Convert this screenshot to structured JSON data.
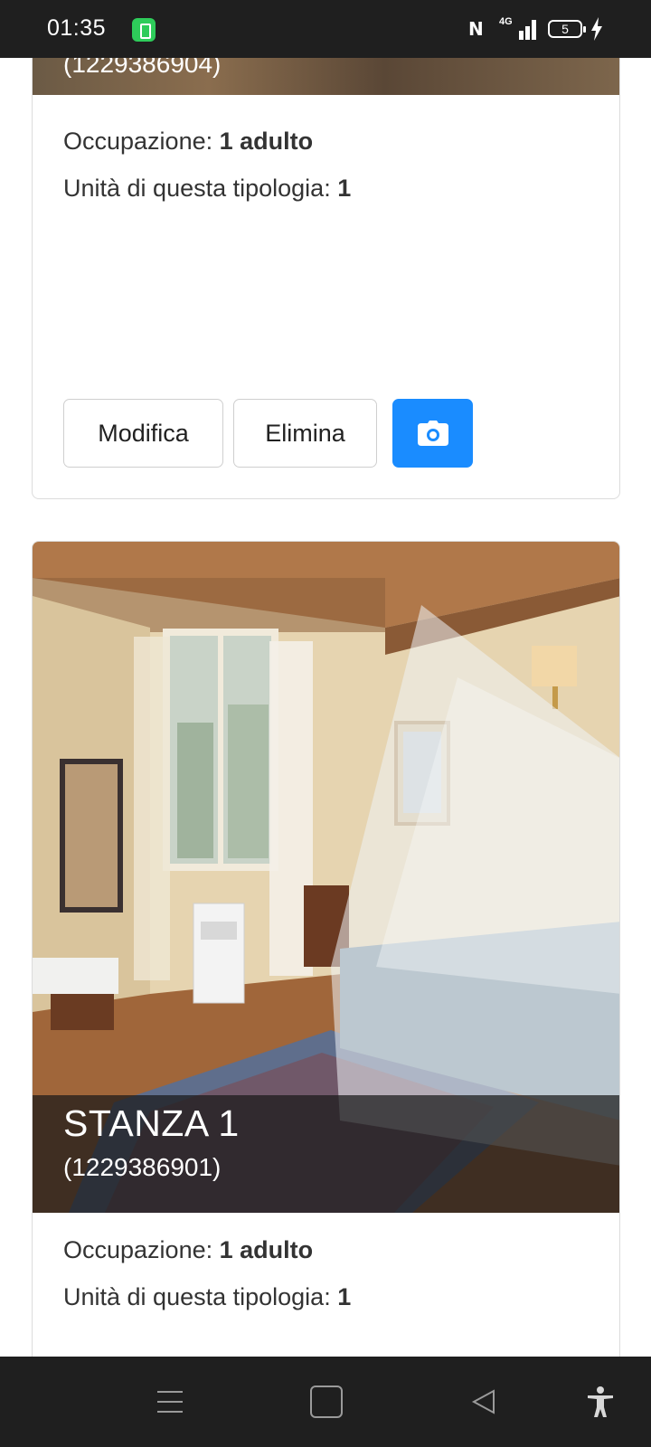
{
  "status_bar": {
    "time": "01:35",
    "network": "4G",
    "battery_level": "5",
    "icons": [
      "battery-saver-icon",
      "nfc-icon",
      "signal-icon",
      "battery-icon",
      "charging-icon"
    ]
  },
  "rooms": [
    {
      "caption_code": "(1229386904)",
      "occupancy_label": "Occupazione:",
      "occupancy_value": "1 adulto",
      "units_label": "Unità di questa tipologia:",
      "units_value": "1",
      "edit_label": "Modifica",
      "delete_label": "Elimina",
      "photo_icon": "camera-icon"
    },
    {
      "title": "STANZA 1",
      "caption_code": "(1229386901)",
      "occupancy_label": "Occupazione:",
      "occupancy_value": "1 adulto",
      "units_label": "Unità di questa tipologia:",
      "units_value": "1"
    }
  ],
  "colors": {
    "accent": "#1a8cff",
    "system_bar": "#1f1f1f",
    "text": "#333333"
  },
  "navigation_bar": {
    "icons": [
      "menu-icon",
      "home-icon",
      "back-icon",
      "accessibility-icon"
    ]
  }
}
